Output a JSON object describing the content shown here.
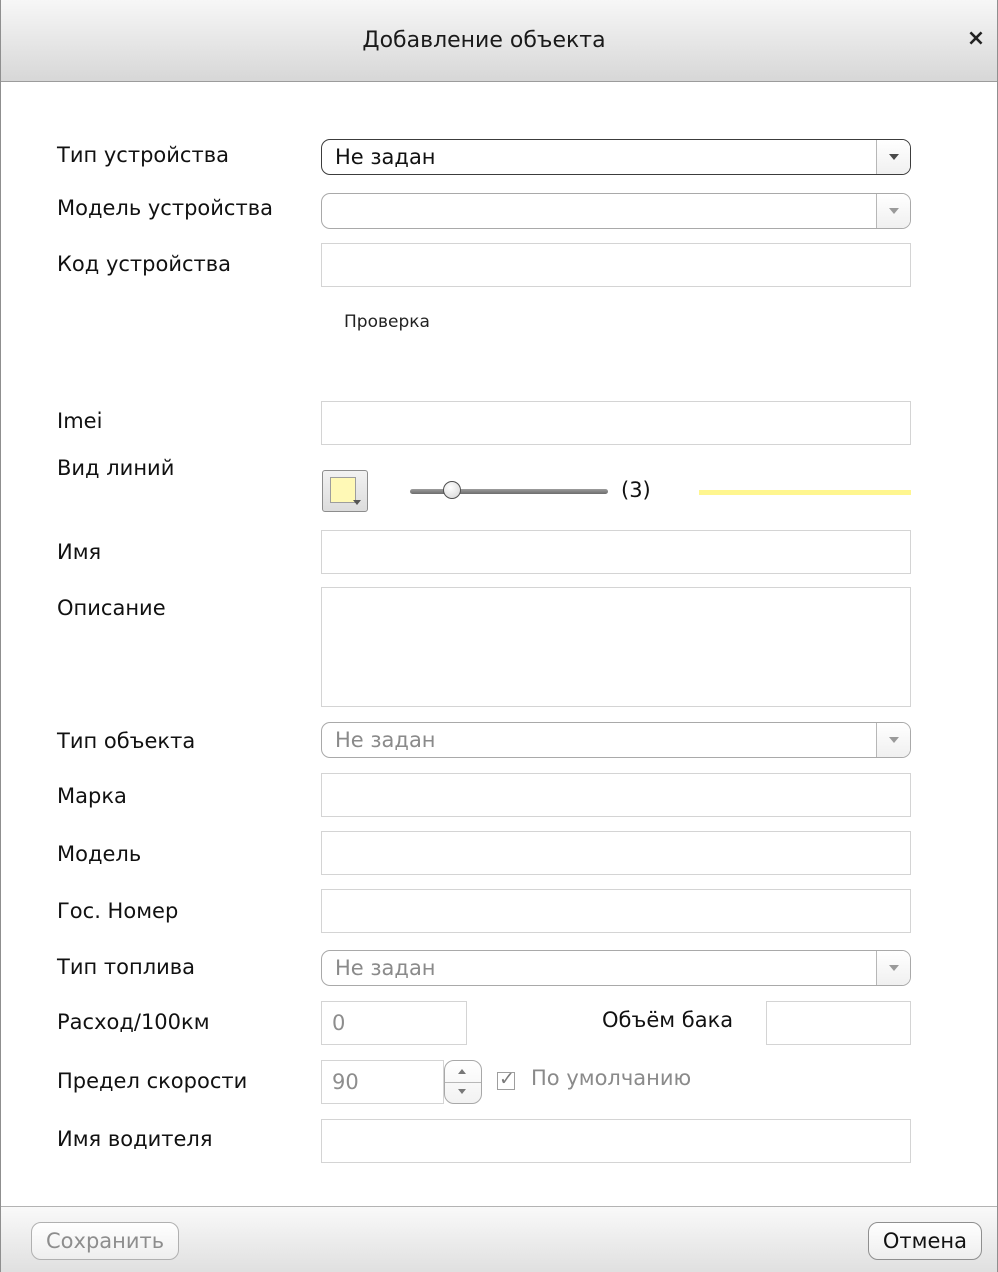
{
  "dialog": {
    "title": "Добавление объекта",
    "close": "×"
  },
  "form": {
    "device_type": {
      "label": "Тип устройства",
      "value": "Не задан"
    },
    "device_model": {
      "label": "Модель устройства",
      "value": ""
    },
    "device_code": {
      "label": "Код устройства",
      "value": ""
    },
    "verify_link": "Проверка",
    "imei": {
      "label": "Imei",
      "value": ""
    },
    "line_style": {
      "label": "Вид линий",
      "color": "#fff9b6",
      "preview_color": "#fff68f",
      "thickness": 3,
      "thickness_text": "(3)",
      "thickness_fraction": 0.2
    },
    "name": {
      "label": "Имя",
      "value": ""
    },
    "description": {
      "label": "Описание",
      "value": ""
    },
    "object_type": {
      "label": "Тип объекта",
      "value": "Не задан"
    },
    "brand": {
      "label": "Марка",
      "value": ""
    },
    "model": {
      "label": "Модель",
      "value": ""
    },
    "license_plate": {
      "label": "Гос. Номер",
      "value": ""
    },
    "fuel_type": {
      "label": "Тип топлива",
      "value": "Не задан"
    },
    "fuel_consumption": {
      "label": "Расход/100км",
      "value": "0"
    },
    "tank_volume": {
      "label": "Объём бака",
      "value": ""
    },
    "speed_limit": {
      "label": "Предел скорости",
      "value": "90",
      "default_checked": true,
      "default_label": "По умолчанию",
      "checkmark": "✓"
    },
    "driver_name": {
      "label": "Имя водителя",
      "value": ""
    }
  },
  "footer": {
    "save_label": "Сохранить",
    "cancel_label": "Отмена"
  }
}
